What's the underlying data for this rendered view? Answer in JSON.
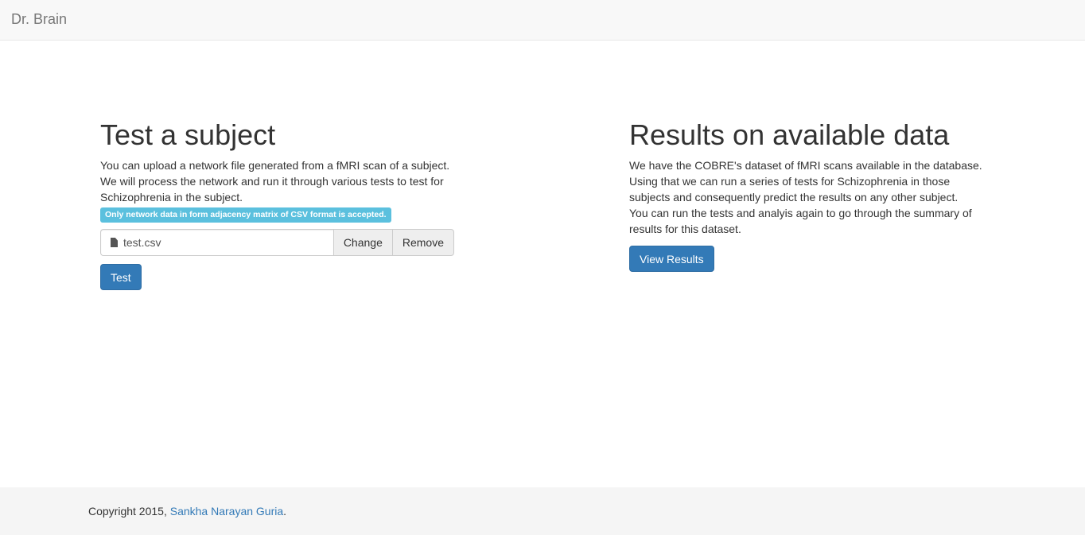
{
  "navbar": {
    "brand": "Dr. Brain"
  },
  "test_section": {
    "title": "Test a subject",
    "description": "You can upload a network file generated from a fMRI scan of a subject. We will process the network and run it through various tests to test for Schizophrenia in the subject.",
    "info_label": "Only network data in form adjacency matrix of CSV format is accepted.",
    "file_name": "test.csv",
    "file_icon": "file-icon",
    "change_label": "Change",
    "remove_label": "Remove",
    "test_button": "Test"
  },
  "results_section": {
    "title": "Results on available data",
    "paragraph1": "We have the COBRE's dataset of fMRI scans available in the database. Using that we can run a series of tests for Schizophrenia in those subjects and consequently predict the results on any other subject.",
    "paragraph2": "You can run the tests and analyis again to go through the summary of results for this dataset.",
    "view_button": "View Results"
  },
  "footer": {
    "copyright": "Copyright 2015, ",
    "author": "Sankha Narayan Guria",
    "suffix": "."
  },
  "colors": {
    "primary": "#337ab7",
    "info": "#5bc0de",
    "navbar_bg": "#f8f8f8",
    "footer_bg": "#f5f5f5"
  }
}
